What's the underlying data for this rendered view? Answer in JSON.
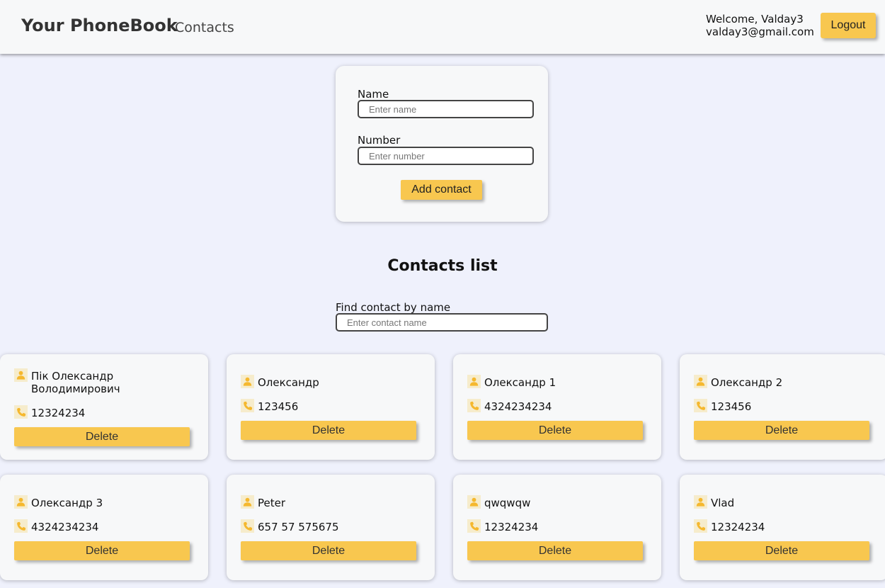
{
  "header": {
    "brand": "Your PhoneBook",
    "nav_contacts": "Contacts",
    "welcome": "Welcome, Valday3",
    "email": "valday3@gmail.com",
    "logout_label": "Logout"
  },
  "form": {
    "name_label": "Name",
    "name_placeholder": "Enter name",
    "number_label": "Number",
    "number_placeholder": "Enter number",
    "add_label": "Add contact"
  },
  "contacts_section": {
    "title": "Contacts list",
    "filter_label": "Find contact by name",
    "filter_placeholder": "Enter contact name",
    "delete_label": "Delete"
  },
  "contacts": [
    {
      "name": "Пік Олександр Володимирович",
      "number": "12324234"
    },
    {
      "name": "Олександр",
      "number": "123456"
    },
    {
      "name": "Олександр 1",
      "number": "4324234234"
    },
    {
      "name": "Олександр 2",
      "number": "123456"
    },
    {
      "name": "Олександр 3",
      "number": "4324234234"
    },
    {
      "name": "Peter",
      "number": "657 57 575675"
    },
    {
      "name": "qwqwqw",
      "number": "12324234"
    },
    {
      "name": "Vlad",
      "number": "12324234"
    }
  ],
  "colors": {
    "accent": "#f8c74f",
    "background": "#eff1fc",
    "card": "#f7f8f9",
    "icon": "#f5b82e"
  },
  "icons": {
    "contact": "person-icon",
    "phone": "phone-icon"
  }
}
